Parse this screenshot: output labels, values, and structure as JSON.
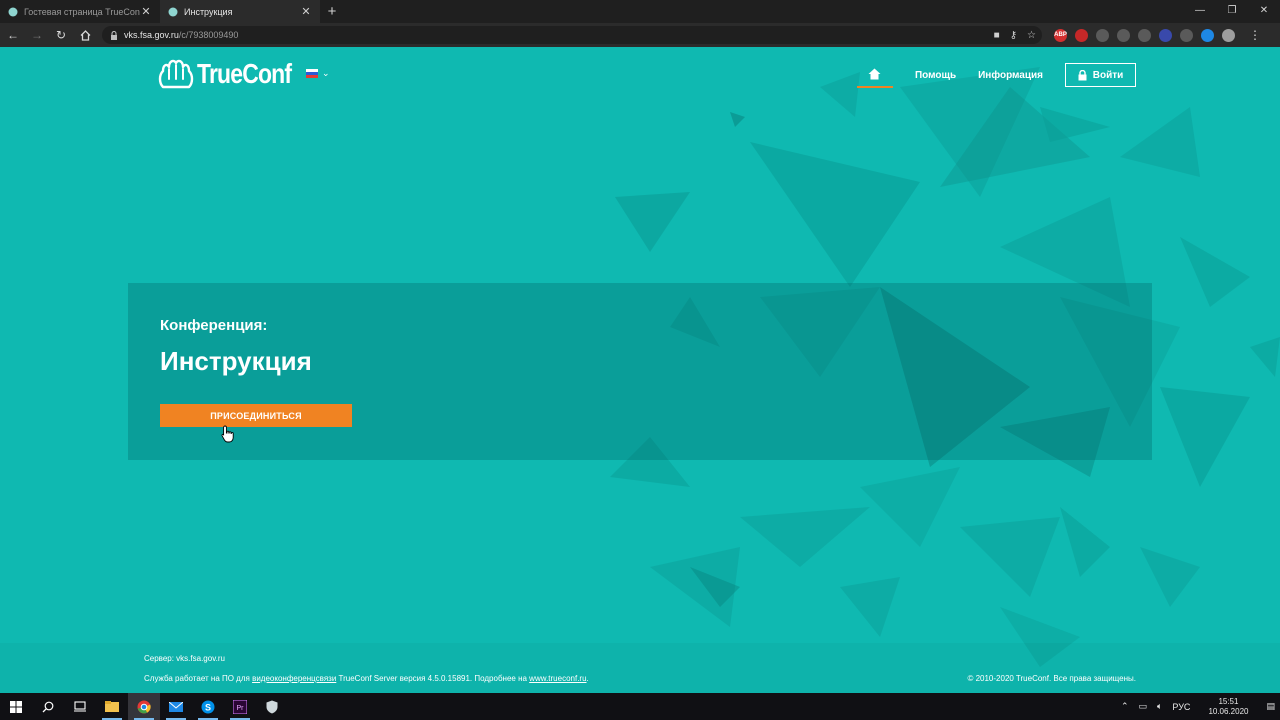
{
  "browser": {
    "tabs": [
      {
        "title": "Гостевая страница TrueConf Se",
        "active": false
      },
      {
        "title": "Инструкция",
        "active": true
      }
    ],
    "new_tab_glyph": "+",
    "window_controls": [
      "—",
      "❐",
      "✕"
    ],
    "url_host": "vks.fsa.gov.ru",
    "url_path": "/c/7938009490",
    "extension_badges": [
      "ABP",
      "",
      "",
      "",
      "",
      "",
      "",
      ""
    ]
  },
  "header": {
    "logo_text": "TrueConf",
    "nav": {
      "help": "Помощь",
      "info": "Информация",
      "login": "Войти"
    }
  },
  "conference": {
    "label": "Конференция:",
    "title": "Инструкция",
    "join_button": "ПРИСОЕДИНИТЬСЯ"
  },
  "footer": {
    "server": "Сервер: vks.fsa.gov.ru",
    "info_prefix": "Служба работает на ПО для ",
    "info_link1": "видеоконференцсвязи",
    "info_middle": " TrueConf Server версия 4.5.0.15891. Подробнее на ",
    "info_link2": "www.trueconf.ru",
    "info_suffix": ".",
    "copyright": "© 2010-2020 TrueConf. Все права защищены."
  },
  "taskbar": {
    "language": "РУС",
    "time": "15:51",
    "date": "10.06.2020"
  },
  "colors": {
    "page_bg": "#0fb9b1",
    "accent_orange": "#f08322",
    "panel_overlay": "rgba(0,90,95,0.28)"
  },
  "icons": [
    "favicon-icon",
    "back-icon",
    "forward-icon",
    "reload-icon",
    "home-icon",
    "lock-icon",
    "star-icon",
    "key-icon",
    "camera-icon",
    "menu-icon",
    "flag-ru-icon",
    "chevron-down-icon",
    "house-icon",
    "padlock-icon",
    "cursor-hand-icon",
    "windows-start-icon",
    "search-icon",
    "task-view-icon",
    "explorer-icon",
    "chrome-icon",
    "mail-icon",
    "skype-icon",
    "premiere-icon",
    "shield-icon"
  ]
}
